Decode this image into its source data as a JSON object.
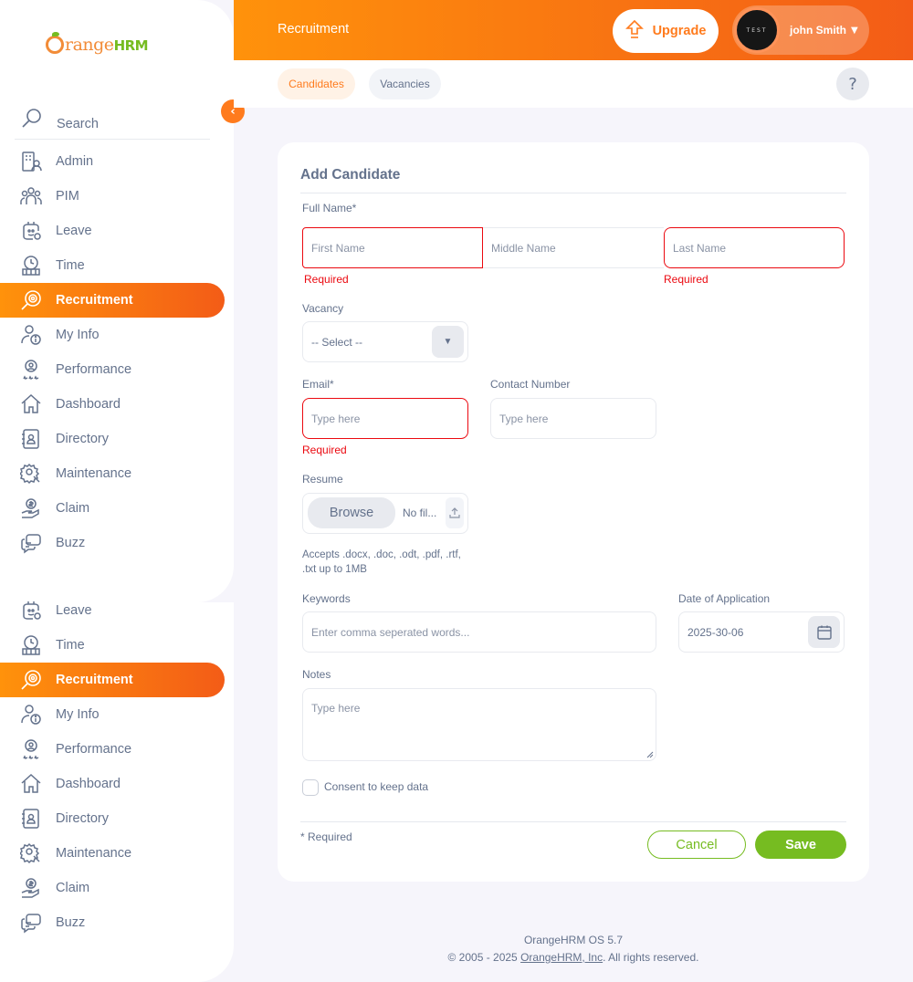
{
  "brand": {
    "logo_main": "range",
    "logo_suffix": "HRM",
    "accent": "#ff7b1d",
    "green": "#76bc21"
  },
  "header": {
    "title": "Recruitment",
    "upgrade_label": "Upgrade",
    "avatar_text": "TEST",
    "user_name": "john Smith"
  },
  "subnav": {
    "tabs": [
      "Candidates",
      "Vacancies"
    ],
    "help_glyph": "?"
  },
  "sidebar": {
    "search_label": "Search",
    "items": [
      {
        "label": "Admin",
        "icon": "admin-icon"
      },
      {
        "label": "PIM",
        "icon": "pim-icon"
      },
      {
        "label": "Leave",
        "icon": "leave-icon"
      },
      {
        "label": "Time",
        "icon": "time-icon"
      },
      {
        "label": "Recruitment",
        "icon": "recruitment-icon",
        "active": true
      },
      {
        "label": "My Info",
        "icon": "myinfo-icon"
      },
      {
        "label": "Performance",
        "icon": "performance-icon"
      },
      {
        "label": "Dashboard",
        "icon": "dashboard-icon"
      },
      {
        "label": "Directory",
        "icon": "directory-icon"
      },
      {
        "label": "Maintenance",
        "icon": "maintenance-icon"
      },
      {
        "label": "Claim",
        "icon": "claim-icon"
      },
      {
        "label": "Buzz",
        "icon": "buzz-icon"
      }
    ],
    "items_repeat": [
      {
        "label": "Leave"
      },
      {
        "label": "Time"
      },
      {
        "label": "Recruitment",
        "active": true
      },
      {
        "label": "My Info"
      },
      {
        "label": "Performance"
      },
      {
        "label": "Dashboard"
      },
      {
        "label": "Directory"
      },
      {
        "label": "Maintenance"
      },
      {
        "label": "Claim"
      },
      {
        "label": "Buzz"
      }
    ]
  },
  "form": {
    "title": "Add Candidate",
    "full_name_label": "Full Name*",
    "first_name_placeholder": "First Name",
    "middle_name_placeholder": "Middle Name",
    "last_name_placeholder": "Last Name",
    "required_msg": "Required",
    "vacancy_label": "Vacancy",
    "vacancy_value": "-- Select --",
    "email_label": "Email*",
    "email_placeholder": "Type here",
    "contact_label": "Contact Number",
    "contact_placeholder": "Type here",
    "resume_label": "Resume",
    "browse_label": "Browse",
    "no_file_text": "No fil...",
    "resume_hint_line1": "Accepts .docx, .doc, .odt, .pdf, .rtf,",
    "resume_hint_line2": ".txt up to 1MB",
    "keywords_label": "Keywords",
    "keywords_placeholder": "Enter comma seperated words...",
    "date_label": "Date of Application",
    "date_value": "2025-30-06",
    "notes_label": "Notes",
    "notes_placeholder": "Type here",
    "consent_label": "Consent to keep data",
    "required_note": "* Required",
    "cancel_label": "Cancel",
    "save_label": "Save"
  },
  "footer": {
    "version": "OrangeHRM OS 5.7",
    "copyright_prefix": "© 2005 - 2025 ",
    "company_link": "OrangeHRM, Inc",
    "copyright_suffix": ". All rights reserved."
  }
}
